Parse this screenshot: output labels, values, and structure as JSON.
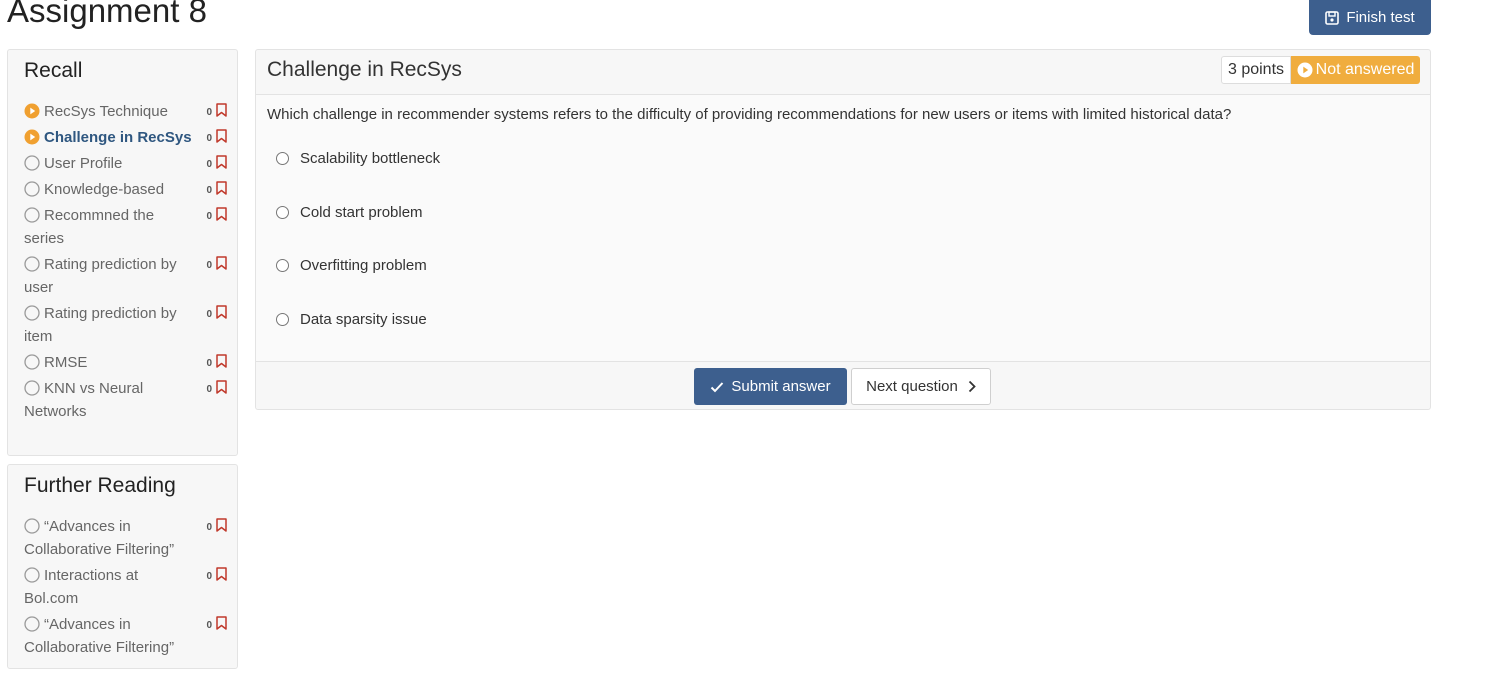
{
  "page": {
    "title": "Assignment 8",
    "finish_label": "Finish test"
  },
  "sidebar": {
    "recall": {
      "title": "Recall",
      "items": [
        {
          "label": "RecSys Technique",
          "count": "0",
          "state": "visited"
        },
        {
          "label": "Challenge in RecSys",
          "count": "0",
          "state": "active"
        },
        {
          "label": "User Profile",
          "count": "0",
          "state": "empty"
        },
        {
          "label": "Knowledge-based",
          "count": "0",
          "state": "empty"
        },
        {
          "label": "Recommned the series",
          "count": "0",
          "state": "empty"
        },
        {
          "label": "Rating prediction by user",
          "count": "0",
          "state": "empty"
        },
        {
          "label": "Rating prediction by item",
          "count": "0",
          "state": "empty"
        },
        {
          "label": "RMSE",
          "count": "0",
          "state": "empty"
        },
        {
          "label": "KNN vs Neural Networks",
          "count": "0",
          "state": "empty"
        }
      ]
    },
    "further_reading": {
      "title": "Further Reading",
      "items": [
        {
          "label": "“Advances in Collaborative Filtering”",
          "count": "0",
          "state": "empty"
        },
        {
          "label": "Interactions at Bol.com",
          "count": "0",
          "state": "empty"
        },
        {
          "label": "“Advances in Collaborative Filtering”",
          "count": "0",
          "state": "empty"
        }
      ]
    }
  },
  "question": {
    "title": "Challenge in RecSys",
    "points": "3 points",
    "status": "Not answered",
    "text": "Which challenge in recommender systems refers to the difficulty of providing recommendations for new users or items with limited historical data?",
    "options": [
      "Scalability bottleneck",
      "Cold start problem",
      "Overfitting problem",
      "Data sparsity issue"
    ],
    "submit_label": "Submit answer",
    "next_label": "Next question"
  },
  "colors": {
    "accent": "#3d5f8e",
    "warning": "#f0ad3e",
    "visited": "#f0a030",
    "bookmark": "#c0392b"
  }
}
